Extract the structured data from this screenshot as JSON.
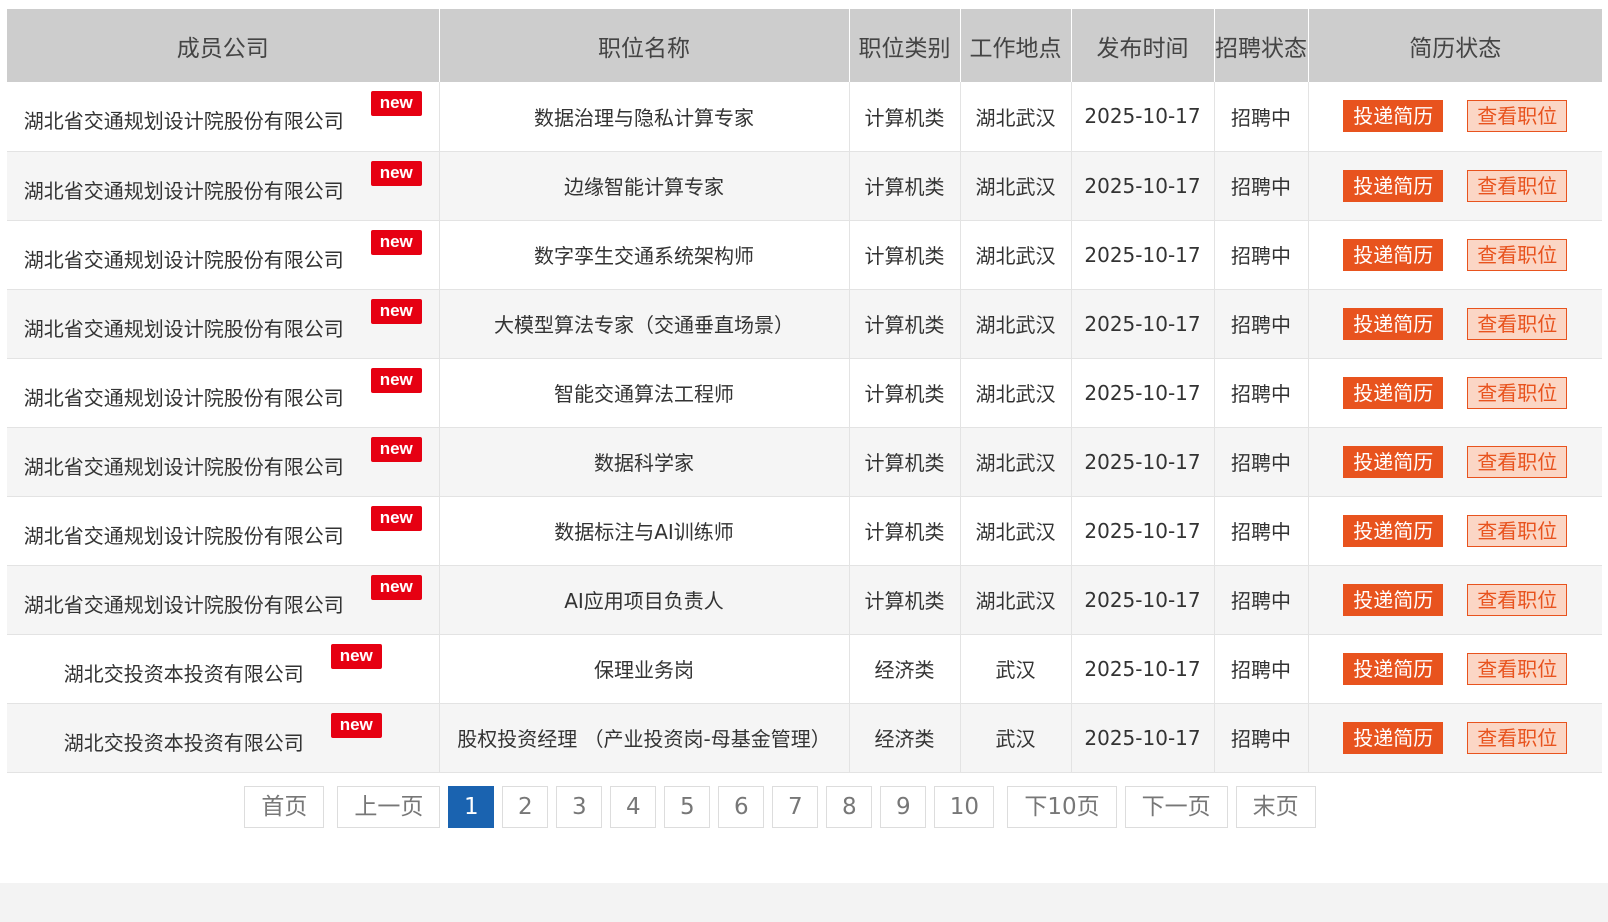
{
  "table": {
    "headers": [
      "成员公司",
      "职位名称",
      "职位类别",
      "工作地点",
      "发布时间",
      "招聘状态",
      "简历状态"
    ],
    "new_badge": "new",
    "apply_label": "投递简历",
    "view_label": "查看职位",
    "rows": [
      {
        "company": "湖北省交通规划设计院股份有限公司",
        "title": "数据治理与隐私计算专家",
        "category": "计算机类",
        "location": "湖北武汉",
        "date": "2025-10-17",
        "status": "招聘中"
      },
      {
        "company": "湖北省交通规划设计院股份有限公司",
        "title": "边缘智能计算专家",
        "category": "计算机类",
        "location": "湖北武汉",
        "date": "2025-10-17",
        "status": "招聘中"
      },
      {
        "company": "湖北省交通规划设计院股份有限公司",
        "title": "数字孪生交通系统架构师",
        "category": "计算机类",
        "location": "湖北武汉",
        "date": "2025-10-17",
        "status": "招聘中"
      },
      {
        "company": "湖北省交通规划设计院股份有限公司",
        "title": "大模型算法专家（交通垂直场景）",
        "category": "计算机类",
        "location": "湖北武汉",
        "date": "2025-10-17",
        "status": "招聘中"
      },
      {
        "company": "湖北省交通规划设计院股份有限公司",
        "title": "智能交通算法工程师",
        "category": "计算机类",
        "location": "湖北武汉",
        "date": "2025-10-17",
        "status": "招聘中"
      },
      {
        "company": "湖北省交通规划设计院股份有限公司",
        "title": "数据科学家",
        "category": "计算机类",
        "location": "湖北武汉",
        "date": "2025-10-17",
        "status": "招聘中"
      },
      {
        "company": "湖北省交通规划设计院股份有限公司",
        "title": "数据标注与AI训练师",
        "category": "计算机类",
        "location": "湖北武汉",
        "date": "2025-10-17",
        "status": "招聘中"
      },
      {
        "company": "湖北省交通规划设计院股份有限公司",
        "title": "AI应用项目负责人",
        "category": "计算机类",
        "location": "湖北武汉",
        "date": "2025-10-17",
        "status": "招聘中"
      },
      {
        "company": "湖北交投资本投资有限公司",
        "title": "保理业务岗",
        "category": "经济类",
        "location": "武汉",
        "date": "2025-10-17",
        "status": "招聘中"
      },
      {
        "company": "湖北交投资本投资有限公司",
        "title": "股权投资经理 （产业投资岗-母基金管理）",
        "category": "经济类",
        "location": "武汉",
        "date": "2025-10-17",
        "status": "招聘中"
      }
    ]
  },
  "pagination": {
    "first": "首页",
    "prev": "上一页",
    "pages": [
      "1",
      "2",
      "3",
      "4",
      "5",
      "6",
      "7",
      "8",
      "9",
      "10"
    ],
    "current": "1",
    "next10": "下10页",
    "next": "下一页",
    "last": "末页",
    "active_color": "#1a63b0"
  },
  "colors": {
    "header_bg": "#cdcdcd",
    "apply_bg": "#e8531e",
    "view_bg": "#fbd6c5",
    "badge_bg": "#e60012"
  }
}
